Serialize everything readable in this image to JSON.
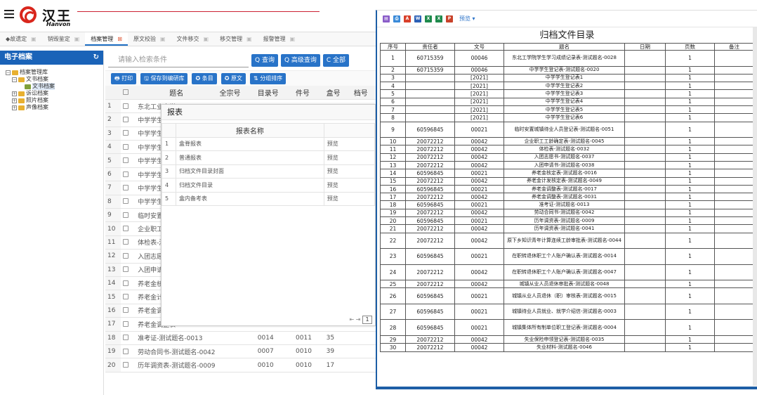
{
  "app": {
    "logo_cn": "汉王",
    "logo_en": "Hanvon"
  },
  "tabs": [
    {
      "label": "◆故遗定"
    },
    {
      "label": "销毁鉴定"
    },
    {
      "label": "档案管理",
      "active": true
    },
    {
      "label": "原文校验"
    },
    {
      "label": "文件移交"
    },
    {
      "label": "移交管理"
    },
    {
      "label": "报警管理"
    }
  ],
  "sidebar": {
    "title": "电子档案",
    "refresh_icon": "refresh-icon",
    "tree": [
      {
        "label": "档案管理库",
        "level": 0,
        "toggle": "−"
      },
      {
        "label": "文书档案",
        "level": 1,
        "toggle": "−"
      },
      {
        "label": "文书档案",
        "level": 2,
        "selected": true
      },
      {
        "label": "诉讼档案",
        "level": 1,
        "toggle": "+"
      },
      {
        "label": "照片档案",
        "level": 1,
        "toggle": "+"
      },
      {
        "label": "声像档案",
        "level": 1,
        "toggle": "+"
      }
    ]
  },
  "search": {
    "placeholder": "请输入检索条件",
    "query": "Q 查询",
    "advanced": "Q 高级查询",
    "all": "C 全部"
  },
  "toolbar": {
    "print": "🖶 打印",
    "save": "🖫 保存到编研库",
    "item": "✪ 条目",
    "original": "✪ 原文",
    "sort": "⇅ 分组排序"
  },
  "grid": {
    "headers": [
      "题名",
      "全宗号",
      "目录号",
      "件号",
      "盒号",
      "档号"
    ],
    "rows": [
      {
        "n": "1",
        "title": "东北工业大学",
        "a": "",
        "b": "",
        "c": "",
        "d": ""
      },
      {
        "n": "2",
        "title": "中学学生登记表",
        "a": "",
        "b": "",
        "c": "",
        "d": ""
      },
      {
        "n": "3",
        "title": "中学学生登记表",
        "a": "",
        "b": "",
        "c": "",
        "d": ""
      },
      {
        "n": "4",
        "title": "中学学生登记表",
        "a": "",
        "b": "",
        "c": "",
        "d": ""
      },
      {
        "n": "5",
        "title": "中学学生登记表",
        "a": "",
        "b": "",
        "c": "",
        "d": ""
      },
      {
        "n": "6",
        "title": "中学学生登记表",
        "a": "",
        "b": "",
        "c": "",
        "d": ""
      },
      {
        "n": "7",
        "title": "中学学生登记表",
        "a": "",
        "b": "",
        "c": "",
        "d": ""
      },
      {
        "n": "8",
        "title": "中学学生登记表",
        "a": "",
        "b": "",
        "c": "",
        "d": ""
      },
      {
        "n": "9",
        "title": "临时安置城镇待业人员",
        "a": "",
        "b": "",
        "c": "",
        "d": ""
      },
      {
        "n": "10",
        "title": "企业职工工龄确定表",
        "a": "",
        "b": "",
        "c": "",
        "d": ""
      },
      {
        "n": "11",
        "title": "体检表-测试题名",
        "a": "",
        "b": "",
        "c": "",
        "d": ""
      },
      {
        "n": "12",
        "title": "入团志愿书",
        "a": "",
        "b": "",
        "c": "",
        "d": ""
      },
      {
        "n": "13",
        "title": "入团申请书",
        "a": "",
        "b": "",
        "c": "",
        "d": ""
      },
      {
        "n": "14",
        "title": "养老金核定表",
        "a": "",
        "b": "",
        "c": "",
        "d": ""
      },
      {
        "n": "15",
        "title": "养老金计发核定表",
        "a": "",
        "b": "",
        "c": "",
        "d": ""
      },
      {
        "n": "16",
        "title": "养老金调整表",
        "a": "",
        "b": "",
        "c": "",
        "d": ""
      },
      {
        "n": "17",
        "title": "养老金调整表",
        "a": "",
        "b": "",
        "c": "",
        "d": ""
      },
      {
        "n": "18",
        "title": "准考证-测试题名-0013",
        "a": "",
        "b": "0014",
        "c": "0011",
        "d": "35"
      },
      {
        "n": "19",
        "title": "劳动合同书-测试题名-0042",
        "a": "",
        "b": "0007",
        "c": "0010",
        "d": "39"
      },
      {
        "n": "20",
        "title": "历年调资表-测试题名-0009",
        "a": "",
        "b": "0010",
        "c": "0010",
        "d": "17"
      }
    ],
    "page_box": "1"
  },
  "report_dialog": {
    "title": "报表",
    "col_header": "报表名称",
    "items": [
      {
        "n": "1",
        "name": "盒脊报表",
        "action": "预览"
      },
      {
        "n": "2",
        "name": "普通报表",
        "action": "预览"
      },
      {
        "n": "3",
        "name": "归档文件目录封面",
        "action": "预览"
      },
      {
        "n": "4",
        "name": "归档文件目录",
        "action": "预览"
      },
      {
        "n": "5",
        "name": "盒内备考表",
        "action": "预览"
      }
    ]
  },
  "report": {
    "preview_label": "预览 ▾",
    "title": "归档文件目录",
    "headers": [
      "序号",
      "责任者",
      "文号",
      "题名",
      "日期",
      "页数",
      "备注"
    ],
    "rows": [
      [
        "1",
        "60715359",
        "00046",
        "东北工学院学生学习成绩记录表-测试题名-0028",
        "",
        "1",
        ""
      ],
      [
        "2",
        "60715359",
        "00046",
        "中学学生登记表-测试题名-0020",
        "",
        "1",
        ""
      ],
      [
        "3",
        "",
        "[2021]",
        "中学学生登记表1",
        "",
        "1",
        ""
      ],
      [
        "4",
        "",
        "[2021]",
        "中学学生登记表2",
        "",
        "1",
        ""
      ],
      [
        "5",
        "",
        "[2021]",
        "中学学生登记表3",
        "",
        "1",
        ""
      ],
      [
        "6",
        "",
        "[2021]",
        "中学学生登记表4",
        "",
        "1",
        ""
      ],
      [
        "7",
        "",
        "[2021]",
        "中学学生登记表5",
        "",
        "1",
        ""
      ],
      [
        "8",
        "",
        "[2021]",
        "中学学生登记表6",
        "",
        "1",
        ""
      ],
      [
        "9",
        "60596845",
        "00021",
        "临时安置城镇待业人员登记表-测试题名-0051",
        "",
        "1",
        ""
      ],
      [
        "10",
        "20072212",
        "00042",
        "企业职工工龄确定表-测试题名-0045",
        "",
        "1",
        ""
      ],
      [
        "11",
        "20072212",
        "00042",
        "体检表-测试题名-0032",
        "",
        "1",
        ""
      ],
      [
        "12",
        "20072212",
        "00042",
        "入团志愿书-测试题名-0037",
        "",
        "1",
        ""
      ],
      [
        "13",
        "20072212",
        "00042",
        "入团申请书-测试题名-0038",
        "",
        "1",
        ""
      ],
      [
        "14",
        "60596845",
        "00021",
        "养老金核定表-测试题名-0016",
        "",
        "1",
        ""
      ],
      [
        "15",
        "20072212",
        "00042",
        "养老金计发核定表-测试题名-0049",
        "",
        "1",
        ""
      ],
      [
        "16",
        "60596845",
        "00021",
        "养老金调整表-测试题名-0017",
        "",
        "1",
        ""
      ],
      [
        "17",
        "20072212",
        "00042",
        "养老金调整表-测试题名-0031",
        "",
        "1",
        ""
      ],
      [
        "18",
        "60596845",
        "00021",
        "准考证-测试题名-0013",
        "",
        "1",
        ""
      ],
      [
        "19",
        "20072212",
        "00042",
        "劳动合同书-测试题名-0042",
        "",
        "1",
        ""
      ],
      [
        "20",
        "60596845",
        "00021",
        "历年调资表-测试题名-0009",
        "",
        "1",
        ""
      ],
      [
        "21",
        "20072212",
        "00042",
        "历年调资表-测试题名-0041",
        "",
        "1",
        ""
      ],
      [
        "22",
        "20072212",
        "00042",
        "原下乡知识青年计算连续工龄审批表-测试题名-0044",
        "",
        "1",
        ""
      ],
      [
        "23",
        "60596845",
        "00021",
        "在职转退休职工个人账户确认表-测试题名-0014",
        "",
        "1",
        ""
      ],
      [
        "24",
        "20072212",
        "00042",
        "在职转退休职工个人账户确认表-测试题名-0047",
        "",
        "1",
        ""
      ],
      [
        "25",
        "20072212",
        "00042",
        "城镇从业人员退休审批表-测试题名-0048",
        "",
        "1",
        ""
      ],
      [
        "26",
        "60596845",
        "00021",
        "城镇从业人员退休（职）审核表-测试题名-0015",
        "",
        "1",
        ""
      ],
      [
        "27",
        "60596845",
        "00021",
        "城镇待业人员就业、就学介绍信-测试题名-0003",
        "",
        "1",
        ""
      ],
      [
        "28",
        "60596845",
        "00021",
        "城镇集体所有制单位职工登记表-测试题名-0004",
        "",
        "1",
        ""
      ],
      [
        "29",
        "20072212",
        "00042",
        "失业保险申领登记表-测试题名-0035",
        "",
        "1",
        ""
      ],
      [
        "30",
        "20072212",
        "00042",
        "失业材料-测试题名-0046",
        "",
        "1",
        ""
      ]
    ]
  }
}
